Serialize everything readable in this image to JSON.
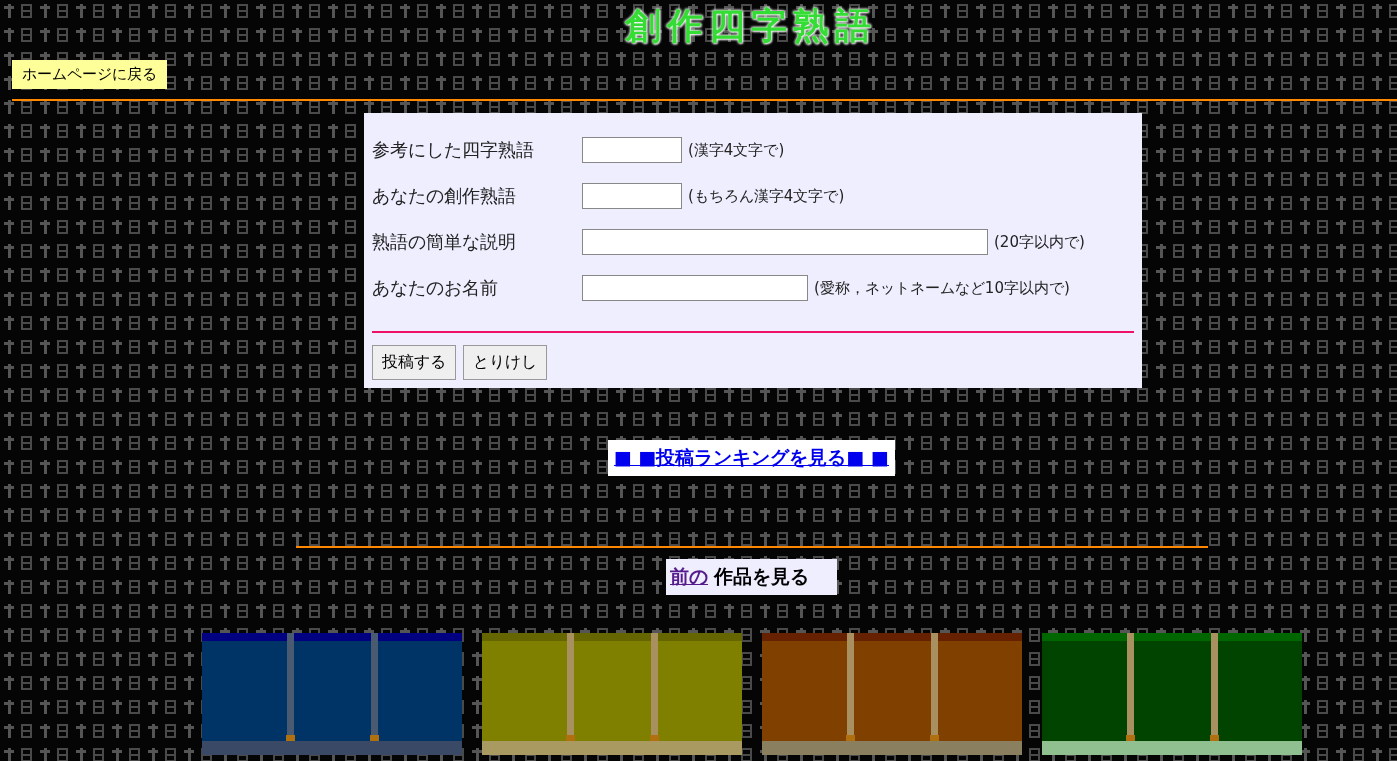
{
  "title": "創作四字熟語",
  "home_button": "ホームページに戻る",
  "form": {
    "fields": [
      {
        "label": "参考にした四字熟語",
        "hint": "(漢字4文字で)"
      },
      {
        "label": "あなたの創作熟語",
        "hint": "(もちろん漢字4文字で)"
      },
      {
        "label": "熟語の簡単な説明",
        "hint": "(20字以内で)"
      },
      {
        "label": "あなたのお名前",
        "hint": "(愛称，ネットネームなど10字以内で)"
      }
    ],
    "buttons": [
      "投稿する",
      "とりけし"
    ]
  },
  "ranking_link": "■ ■投稿ランキングを見る■ ■",
  "previous": {
    "link": "前の",
    "text": "作品を見る"
  }
}
